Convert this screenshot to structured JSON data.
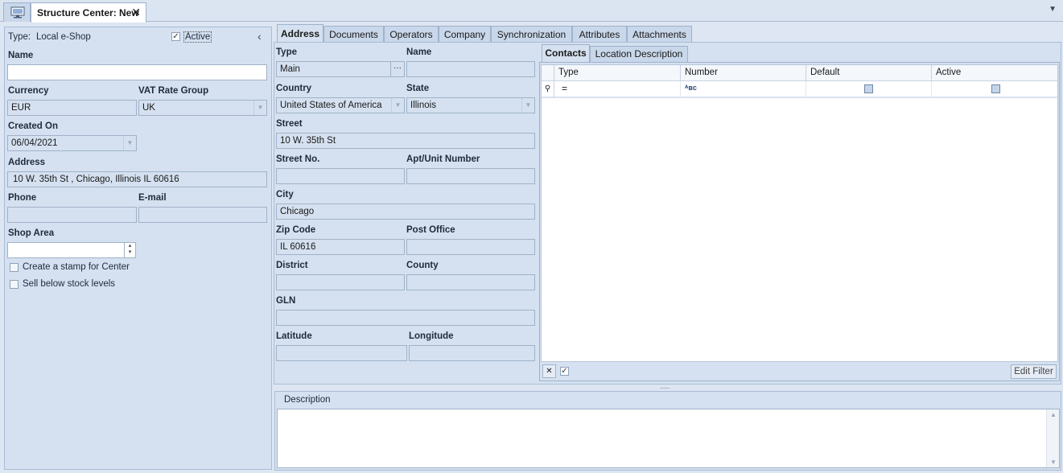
{
  "window": {
    "tab_title": "Structure Center: New",
    "close_glyph": "✕",
    "menu_arrow": "▼"
  },
  "left": {
    "type_label": "Type:",
    "type_value": "Local e-Shop",
    "active_label": "Active",
    "active_checked": true,
    "collapse_glyph": "‹",
    "name_label": "Name",
    "name_value": "",
    "currency_label": "Currency",
    "currency_value": "EUR",
    "vat_label": "VAT Rate Group",
    "vat_value": "UK",
    "created_label": "Created On",
    "created_value": "06/04/2021",
    "address_label": "Address",
    "address_value": "10 W. 35th St , Chicago, Illinois IL 60616",
    "phone_label": "Phone",
    "phone_value": "",
    "email_label": "E-mail",
    "email_value": "",
    "shop_area_label": "Shop Area",
    "shop_area_value": "",
    "stamp_label": "Create a stamp for Center",
    "sell_below_label": "Sell below stock levels"
  },
  "tabs": [
    "Address",
    "Documents",
    "Operators",
    "Company",
    "Synchronization",
    "Attributes",
    "Attachments"
  ],
  "address": {
    "type_label": "Type",
    "type_value": "Main",
    "ellipsis": "···",
    "name_label": "Name",
    "name_value": "",
    "country_label": "Country",
    "country_value": "United States of America",
    "state_label": "State",
    "state_value": "Illinois",
    "street_label": "Street",
    "street_value": "10 W. 35th St",
    "street_no_label": "Street No.",
    "street_no_value": "",
    "apt_label": "Apt/Unit Number",
    "apt_value": "",
    "city_label": "City",
    "city_value": "Chicago",
    "zip_label": "Zip Code",
    "zip_value": "IL 60616",
    "post_office_label": "Post Office",
    "post_office_value": "",
    "district_label": "District",
    "district_value": "",
    "county_label": "County",
    "county_value": "",
    "gln_label": "GLN",
    "gln_value": "",
    "latitude_label": "Latitude",
    "latitude_value": "",
    "longitude_label": "Longitude",
    "longitude_value": ""
  },
  "contacts": {
    "tabs": [
      "Contacts",
      "Location Description"
    ],
    "columns": [
      "Type",
      "Number",
      "Default",
      "Active"
    ],
    "filter_row": {
      "pin_glyph": "⚲",
      "type_filter": "=",
      "number_filter": "ᴬʙᴄ"
    },
    "footer": {
      "clear_glyph": "✕",
      "check_glyph": "✓",
      "edit_filter": "Edit Filter"
    },
    "splitter_glyph": "....."
  },
  "description": {
    "label": "Description",
    "value": "",
    "scroll_up": "▲",
    "scroll_down": "▼"
  },
  "colors": {
    "panel_bg": "#d5e1f0",
    "border": "#a9bcd6",
    "active_tab": "#d5e1f0"
  }
}
